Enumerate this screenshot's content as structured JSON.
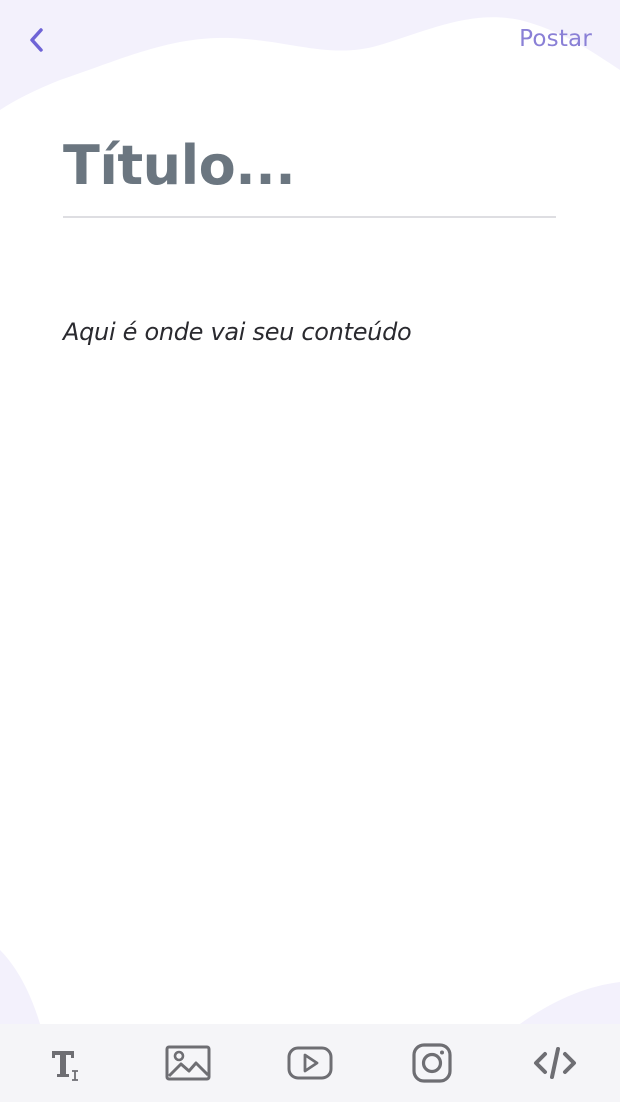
{
  "header": {
    "back_icon": "chevron-left-icon",
    "post_label": "Postar"
  },
  "editor": {
    "title_placeholder": "Título...",
    "content_placeholder": "Aqui é onde vai seu conteúdo"
  },
  "toolbar": {
    "items": [
      {
        "icon": "text-format-icon"
      },
      {
        "icon": "image-icon"
      },
      {
        "icon": "video-play-icon"
      },
      {
        "icon": "instagram-icon"
      },
      {
        "icon": "code-icon"
      }
    ]
  },
  "colors": {
    "accent": "#8a80d6",
    "back_arrow": "#6f64d6",
    "title_text": "#6b7680",
    "content_text": "#2a2a2f",
    "toolbar_bg": "#f5f5f8",
    "toolbar_icon": "#6e6e73",
    "wave": "#f2f0fc"
  }
}
